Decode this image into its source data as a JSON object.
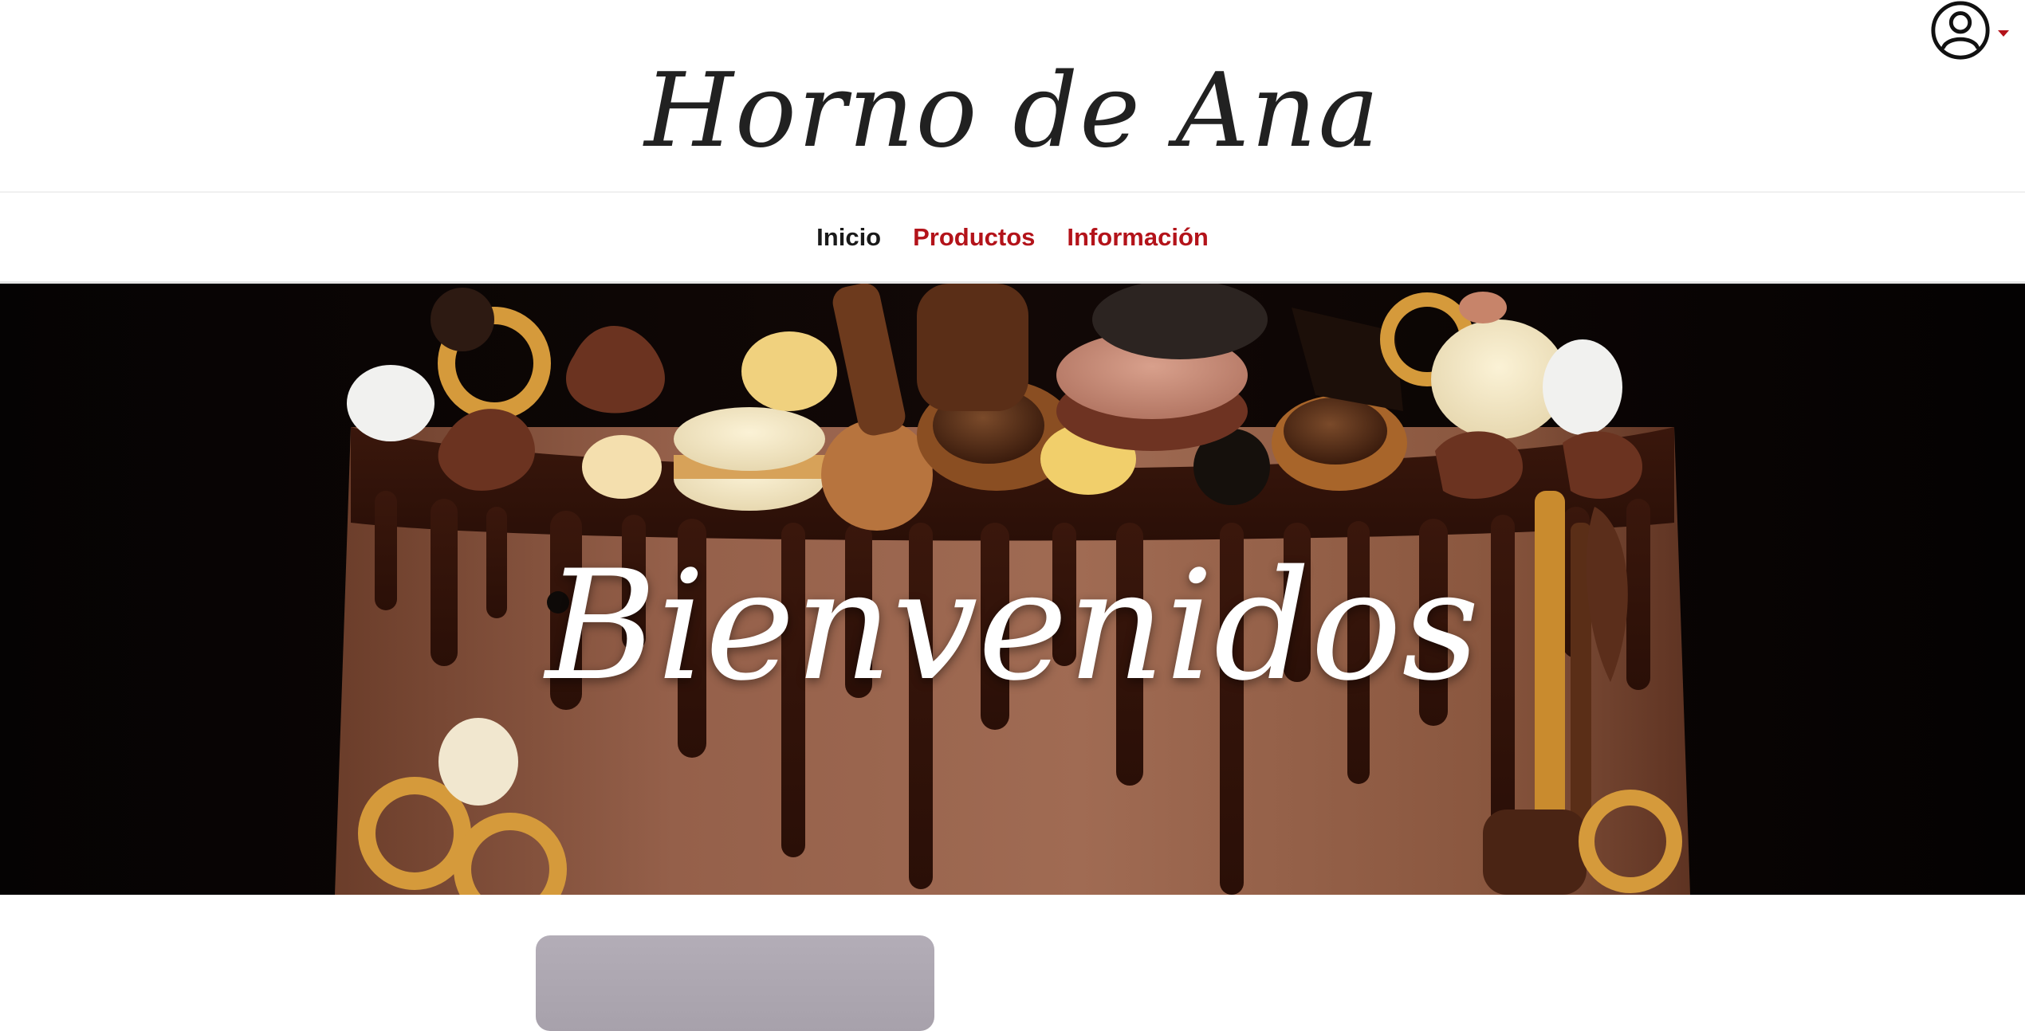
{
  "header": {
    "brand": "Horno de Ana",
    "account_icon": "user-circle-icon",
    "accent_color": "#b3131a"
  },
  "nav": {
    "items": [
      {
        "label": "Inicio",
        "active": true
      },
      {
        "label": "Productos",
        "active": false
      },
      {
        "label": "Información",
        "active": false
      }
    ]
  },
  "hero": {
    "title": "Bienvenidos",
    "image": "chocolate-drip-cake"
  },
  "content": {
    "card_image": "product-card-image"
  }
}
